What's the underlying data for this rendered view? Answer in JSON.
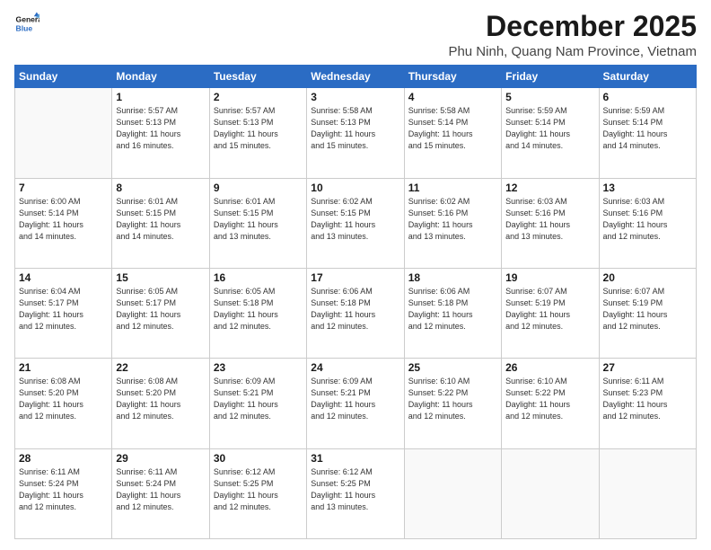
{
  "header": {
    "logo_line1": "General",
    "logo_line2": "Blue",
    "title": "December 2025",
    "subtitle": "Phu Ninh, Quang Nam Province, Vietnam"
  },
  "weekdays": [
    "Sunday",
    "Monday",
    "Tuesday",
    "Wednesday",
    "Thursday",
    "Friday",
    "Saturday"
  ],
  "weeks": [
    [
      {
        "day": "",
        "info": ""
      },
      {
        "day": "1",
        "info": "Sunrise: 5:57 AM\nSunset: 5:13 PM\nDaylight: 11 hours\nand 16 minutes."
      },
      {
        "day": "2",
        "info": "Sunrise: 5:57 AM\nSunset: 5:13 PM\nDaylight: 11 hours\nand 15 minutes."
      },
      {
        "day": "3",
        "info": "Sunrise: 5:58 AM\nSunset: 5:13 PM\nDaylight: 11 hours\nand 15 minutes."
      },
      {
        "day": "4",
        "info": "Sunrise: 5:58 AM\nSunset: 5:14 PM\nDaylight: 11 hours\nand 15 minutes."
      },
      {
        "day": "5",
        "info": "Sunrise: 5:59 AM\nSunset: 5:14 PM\nDaylight: 11 hours\nand 14 minutes."
      },
      {
        "day": "6",
        "info": "Sunrise: 5:59 AM\nSunset: 5:14 PM\nDaylight: 11 hours\nand 14 minutes."
      }
    ],
    [
      {
        "day": "7",
        "info": "Sunrise: 6:00 AM\nSunset: 5:14 PM\nDaylight: 11 hours\nand 14 minutes."
      },
      {
        "day": "8",
        "info": "Sunrise: 6:01 AM\nSunset: 5:15 PM\nDaylight: 11 hours\nand 14 minutes."
      },
      {
        "day": "9",
        "info": "Sunrise: 6:01 AM\nSunset: 5:15 PM\nDaylight: 11 hours\nand 13 minutes."
      },
      {
        "day": "10",
        "info": "Sunrise: 6:02 AM\nSunset: 5:15 PM\nDaylight: 11 hours\nand 13 minutes."
      },
      {
        "day": "11",
        "info": "Sunrise: 6:02 AM\nSunset: 5:16 PM\nDaylight: 11 hours\nand 13 minutes."
      },
      {
        "day": "12",
        "info": "Sunrise: 6:03 AM\nSunset: 5:16 PM\nDaylight: 11 hours\nand 13 minutes."
      },
      {
        "day": "13",
        "info": "Sunrise: 6:03 AM\nSunset: 5:16 PM\nDaylight: 11 hours\nand 12 minutes."
      }
    ],
    [
      {
        "day": "14",
        "info": "Sunrise: 6:04 AM\nSunset: 5:17 PM\nDaylight: 11 hours\nand 12 minutes."
      },
      {
        "day": "15",
        "info": "Sunrise: 6:05 AM\nSunset: 5:17 PM\nDaylight: 11 hours\nand 12 minutes."
      },
      {
        "day": "16",
        "info": "Sunrise: 6:05 AM\nSunset: 5:18 PM\nDaylight: 11 hours\nand 12 minutes."
      },
      {
        "day": "17",
        "info": "Sunrise: 6:06 AM\nSunset: 5:18 PM\nDaylight: 11 hours\nand 12 minutes."
      },
      {
        "day": "18",
        "info": "Sunrise: 6:06 AM\nSunset: 5:18 PM\nDaylight: 11 hours\nand 12 minutes."
      },
      {
        "day": "19",
        "info": "Sunrise: 6:07 AM\nSunset: 5:19 PM\nDaylight: 11 hours\nand 12 minutes."
      },
      {
        "day": "20",
        "info": "Sunrise: 6:07 AM\nSunset: 5:19 PM\nDaylight: 11 hours\nand 12 minutes."
      }
    ],
    [
      {
        "day": "21",
        "info": "Sunrise: 6:08 AM\nSunset: 5:20 PM\nDaylight: 11 hours\nand 12 minutes."
      },
      {
        "day": "22",
        "info": "Sunrise: 6:08 AM\nSunset: 5:20 PM\nDaylight: 11 hours\nand 12 minutes."
      },
      {
        "day": "23",
        "info": "Sunrise: 6:09 AM\nSunset: 5:21 PM\nDaylight: 11 hours\nand 12 minutes."
      },
      {
        "day": "24",
        "info": "Sunrise: 6:09 AM\nSunset: 5:21 PM\nDaylight: 11 hours\nand 12 minutes."
      },
      {
        "day": "25",
        "info": "Sunrise: 6:10 AM\nSunset: 5:22 PM\nDaylight: 11 hours\nand 12 minutes."
      },
      {
        "day": "26",
        "info": "Sunrise: 6:10 AM\nSunset: 5:22 PM\nDaylight: 11 hours\nand 12 minutes."
      },
      {
        "day": "27",
        "info": "Sunrise: 6:11 AM\nSunset: 5:23 PM\nDaylight: 11 hours\nand 12 minutes."
      }
    ],
    [
      {
        "day": "28",
        "info": "Sunrise: 6:11 AM\nSunset: 5:24 PM\nDaylight: 11 hours\nand 12 minutes."
      },
      {
        "day": "29",
        "info": "Sunrise: 6:11 AM\nSunset: 5:24 PM\nDaylight: 11 hours\nand 12 minutes."
      },
      {
        "day": "30",
        "info": "Sunrise: 6:12 AM\nSunset: 5:25 PM\nDaylight: 11 hours\nand 12 minutes."
      },
      {
        "day": "31",
        "info": "Sunrise: 6:12 AM\nSunset: 5:25 PM\nDaylight: 11 hours\nand 13 minutes."
      },
      {
        "day": "",
        "info": ""
      },
      {
        "day": "",
        "info": ""
      },
      {
        "day": "",
        "info": ""
      }
    ]
  ]
}
